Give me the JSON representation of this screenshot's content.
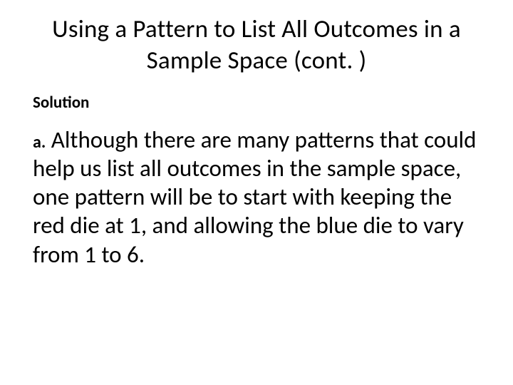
{
  "title": "Using a Pattern to List All Outcomes in a Sample Space (cont. )",
  "subhead": "Solution",
  "itemMarker": "a.",
  "bodyText": " Although there are many patterns that could help us list all outcomes in the sample space, one pattern will be to start with keeping the red die at 1, and allowing the blue die to vary from 1 to 6."
}
